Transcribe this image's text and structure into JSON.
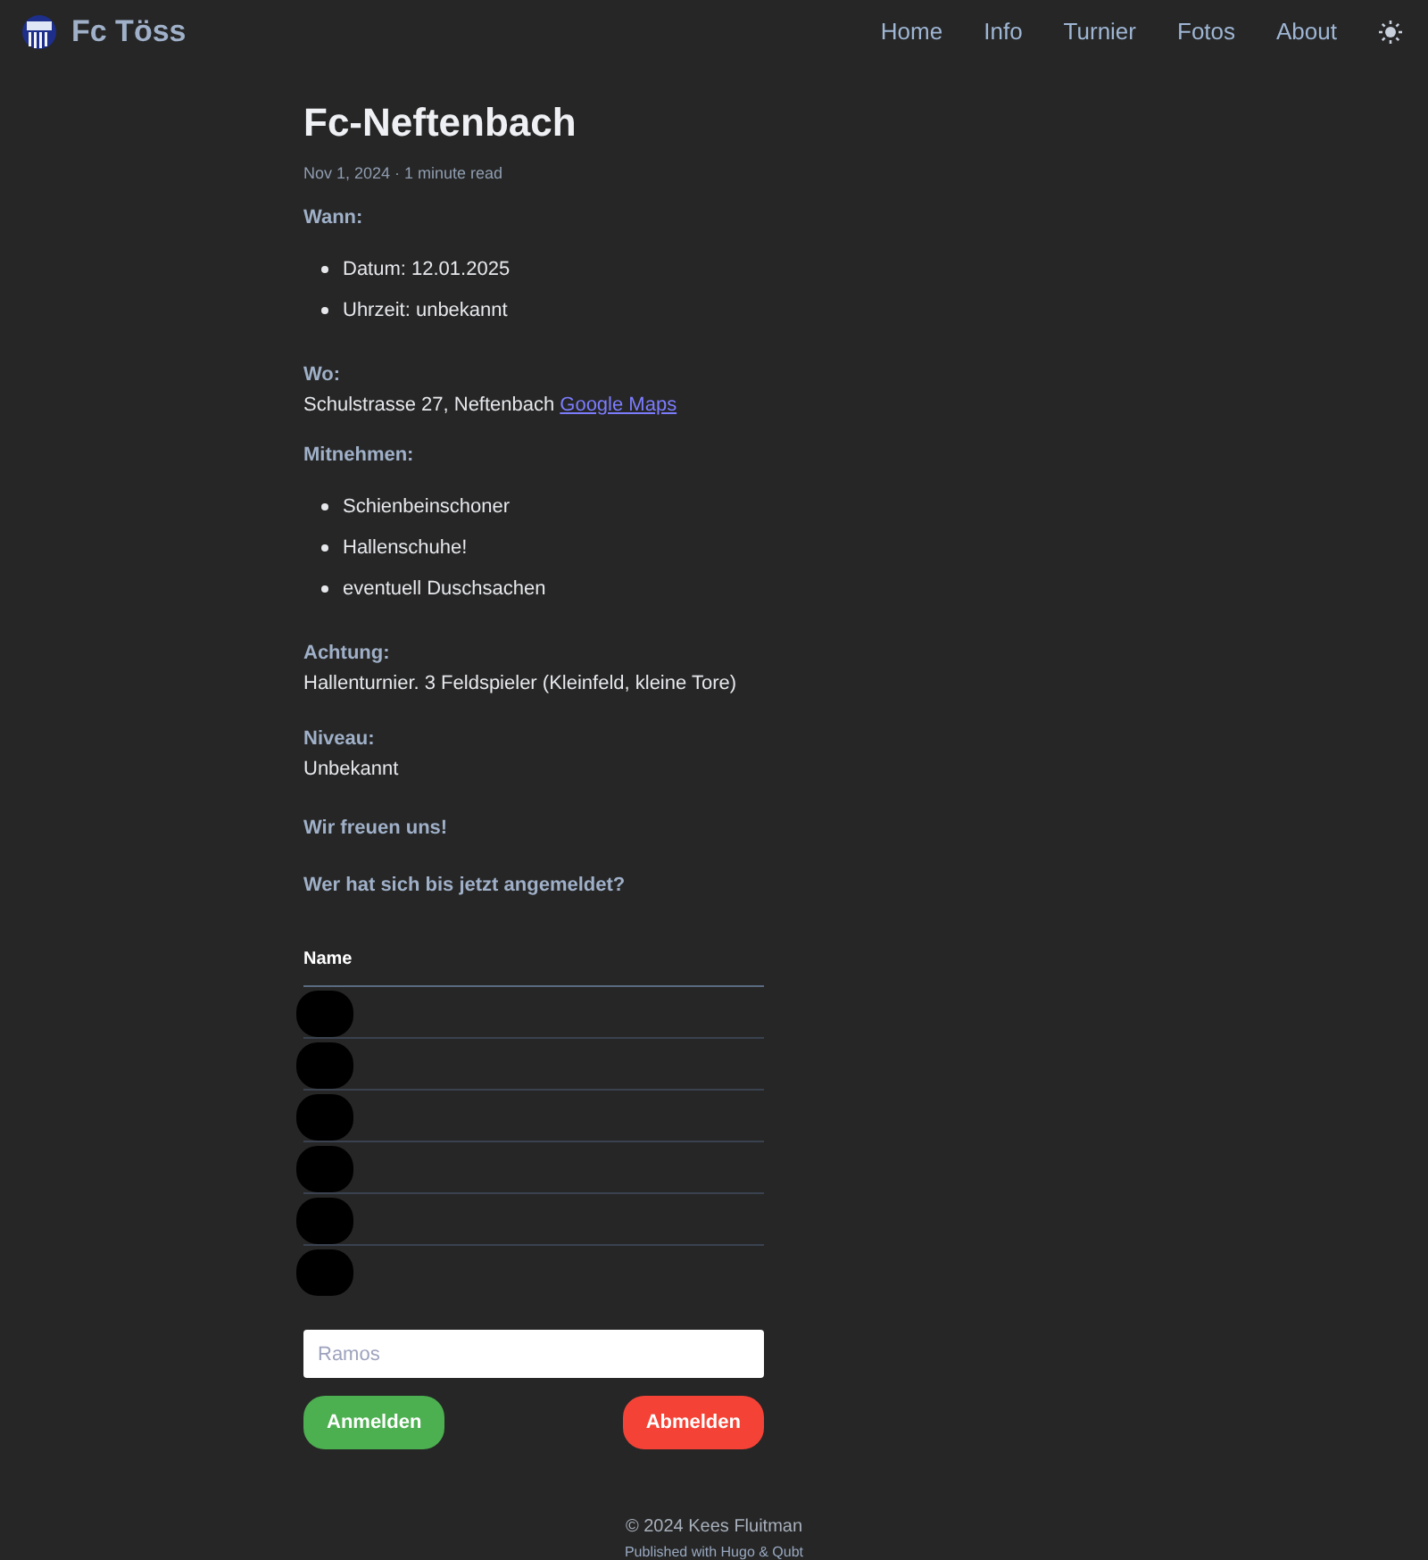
{
  "header": {
    "site_title": "Fc Töss",
    "nav": [
      {
        "label": "Home"
      },
      {
        "label": "Info"
      },
      {
        "label": "Turnier"
      },
      {
        "label": "Fotos"
      },
      {
        "label": "About"
      }
    ]
  },
  "post": {
    "title": "Fc-Neftenbach",
    "meta": "Nov 1, 2024 · 1 minute read",
    "sections": [
      {
        "kind": "list",
        "label": "Wann:",
        "items": [
          "Datum: 12.01.2025",
          "Uhrzeit: unbekannt"
        ]
      },
      {
        "kind": "text",
        "label": "Wo:",
        "text": "Schulstrasse 27, Neftenbach",
        "link": "Google Maps"
      },
      {
        "kind": "list",
        "label": "Mitnehmen:",
        "items": [
          "Schienbeinschoner",
          "Hallenschuhe!",
          "eventuell Duschsachen"
        ]
      },
      {
        "kind": "text",
        "label": "Achtung:",
        "text": "Hallenturnier. 3 Feldspieler (Kleinfeld, kleine Tore)"
      },
      {
        "kind": "text",
        "label": "Niveau:",
        "text": "Unbekannt"
      },
      {
        "kind": "label",
        "label": "Wir freuen uns!"
      },
      {
        "kind": "label",
        "label": "Wer hat sich bis jetzt angemeldet?"
      }
    ]
  },
  "table": {
    "columns": [
      "Name"
    ],
    "rows": [
      {
        "kind": "redacted"
      },
      {
        "kind": "redacted"
      },
      {
        "kind": "redacted"
      },
      {
        "kind": "redacted"
      },
      {
        "kind": "redacted"
      },
      {
        "kind": "redacted"
      }
    ]
  },
  "form": {
    "placeholder": "Ramos",
    "buttons": [
      {
        "kind": "primary",
        "label": "Anmelden"
      },
      {
        "kind": "danger",
        "label": "Abmelden"
      }
    ]
  },
  "footer": {
    "copyright": "© 2024 Kees Fluitman",
    "published": "Published with Hugo & Qubt"
  }
}
